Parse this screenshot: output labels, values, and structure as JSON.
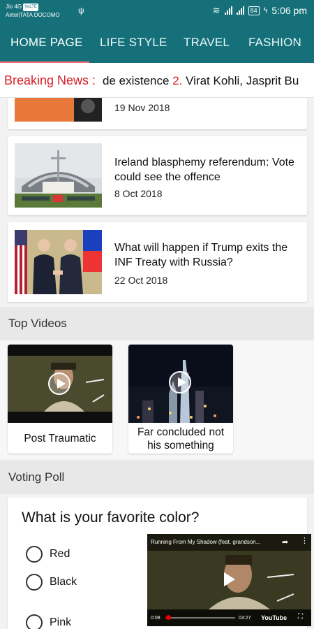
{
  "status_bar": {
    "carrier_line1": "Jio 4G",
    "volte": "VoLTE",
    "carrier_line2": "Airtel|TATA DOCOMO",
    "usb_symbol": "ψ",
    "wifi_symbol": "≋",
    "battery": "84",
    "charging_symbol": "ϟ",
    "time": "5:06 pm"
  },
  "tabs": [
    {
      "label": "HOME PAGE",
      "active": true
    },
    {
      "label": "LIFE STYLE",
      "active": false
    },
    {
      "label": "TRAVEL",
      "active": false
    },
    {
      "label": "FASHION",
      "active": false
    }
  ],
  "breaking": {
    "label": "Breaking News :",
    "text_before": "de existence",
    "number": "2.",
    "text_after": "Virat Kohli, Jasprit Bu"
  },
  "news": [
    {
      "headline": "",
      "date": "19 Nov 2018"
    },
    {
      "headline": "Ireland blasphemy referendum: Vote could see the offence",
      "date": "8 Oct 2018"
    },
    {
      "headline": "What will happen if Trump exits the INF Treaty with Russia?",
      "date": "22 Oct 2018"
    }
  ],
  "top_videos": {
    "header": "Top Videos",
    "items": [
      {
        "title": "Post Traumatic"
      },
      {
        "title": "Far concluded not his something"
      }
    ]
  },
  "poll": {
    "header": "Voting Poll",
    "question": "What is your favorite color?",
    "options": [
      "Red",
      "Black",
      "Pink"
    ]
  },
  "player": {
    "title": "Running From My Shadow (feat. grandson...",
    "share_icon": "➦",
    "more_icon": "⋮",
    "current_time": "0:08",
    "duration": "03:27",
    "logo": "YouTube",
    "fullscreen_icon": "⛶",
    "progress": 0.04
  },
  "colors": {
    "primary": "#15707a",
    "accent": "#ff6f7b",
    "breaking": "#d62027"
  }
}
